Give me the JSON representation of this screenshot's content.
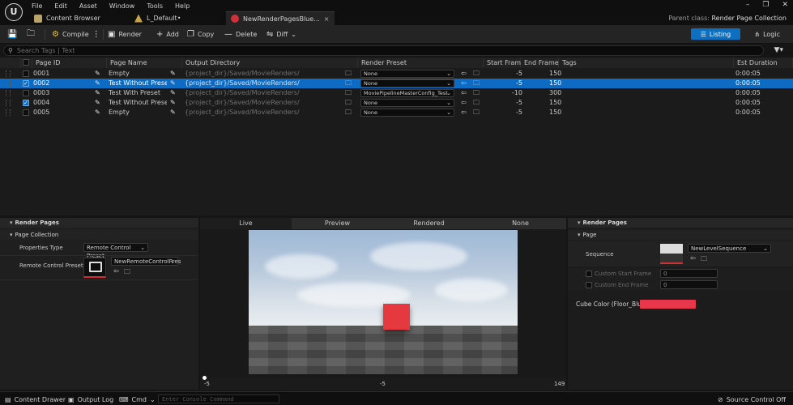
{
  "titlebar": {
    "logo": "U",
    "menu": [
      "File",
      "Edit",
      "Asset",
      "Window",
      "Tools",
      "Help"
    ],
    "tabs": [
      {
        "label": "Content Browser",
        "icon": "folder-icon"
      },
      {
        "label": "L_Default•",
        "icon": "level-icon"
      },
      {
        "label": "NewRenderPagesBlue...",
        "icon": "blueprint-icon",
        "close": "×"
      }
    ],
    "parent_class_label": "Parent class:",
    "parent_class_value": "Render Page Collection",
    "window_buttons": [
      "–",
      "❐",
      "✕"
    ]
  },
  "toolbar": {
    "compile": "Compile",
    "render": "Render",
    "add": "Add",
    "copy": "Copy",
    "delete": "Delete",
    "diff": "Diff",
    "listing": "Listing",
    "logic": "Logic"
  },
  "search": {
    "placeholder": "Search Tags | Text"
  },
  "table": {
    "headers": [
      "Page ID",
      "Page Name",
      "Output Directory",
      "Render Preset",
      "Start Frame",
      "End Frame",
      "Tags",
      "Est Duration"
    ],
    "rows": [
      {
        "id": "0001",
        "name": "Empty",
        "dir": "{project_dir}/Saved/MovieRenders/",
        "preset": "None",
        "start": "-5",
        "end": "150",
        "duration": "0:00:05",
        "checked": false,
        "selected": false
      },
      {
        "id": "0002",
        "name": "Test Without Preset",
        "dir": "{project_dir}/Saved/MovieRenders/",
        "preset": "None",
        "start": "-5",
        "end": "150",
        "duration": "0:00:05",
        "checked": true,
        "selected": true
      },
      {
        "id": "0003",
        "name": "Test With Preset",
        "dir": "{project_dir}/Saved/MovieRenders/",
        "preset": "MoviePipelineMasterConfig_Test",
        "start": "-10",
        "end": "300",
        "duration": "0:00:05",
        "checked": false,
        "selected": false
      },
      {
        "id": "0004",
        "name": "Test Without Preset",
        "dir": "{project_dir}/Saved/MovieRenders/",
        "preset": "None",
        "start": "-5",
        "end": "150",
        "duration": "0:00:05",
        "checked": true,
        "selected": false
      },
      {
        "id": "0005",
        "name": "Empty",
        "dir": "{project_dir}/Saved/MovieRenders/",
        "preset": "None",
        "start": "-5",
        "end": "150",
        "duration": "0:00:05",
        "checked": false,
        "selected": false
      }
    ]
  },
  "left_panel": {
    "title": "Render Pages",
    "section": "Page Collection",
    "properties_type_label": "Properties Type",
    "properties_type_value": "Remote Control Preset",
    "rc_preset_label": "Remote Control Preset",
    "rc_preset_value": "NewRemoteControlPres"
  },
  "viewport": {
    "tabs": [
      "Live",
      "Preview",
      "Rendered",
      "None"
    ],
    "timeline_start": "-5",
    "timeline_current": "-5",
    "timeline_end": "149"
  },
  "right_panel": {
    "title": "Render Pages",
    "section": "Page",
    "sequence_label": "Sequence",
    "sequence_value": "NewLevelSequence",
    "custom_start_label": "Custom Start Frame",
    "custom_start_value": "0",
    "custom_end_label": "Custom End Frame",
    "custom_end_value": "0",
    "cube_color_label": "Cube Color (Floor_Blue",
    "cube_color": "#e8374a"
  },
  "statusbar": {
    "content_drawer": "Content Drawer",
    "output_log": "Output Log",
    "cmd": "Cmd",
    "console_placeholder": "Enter Console Command",
    "source_control": "Source Control Off"
  }
}
